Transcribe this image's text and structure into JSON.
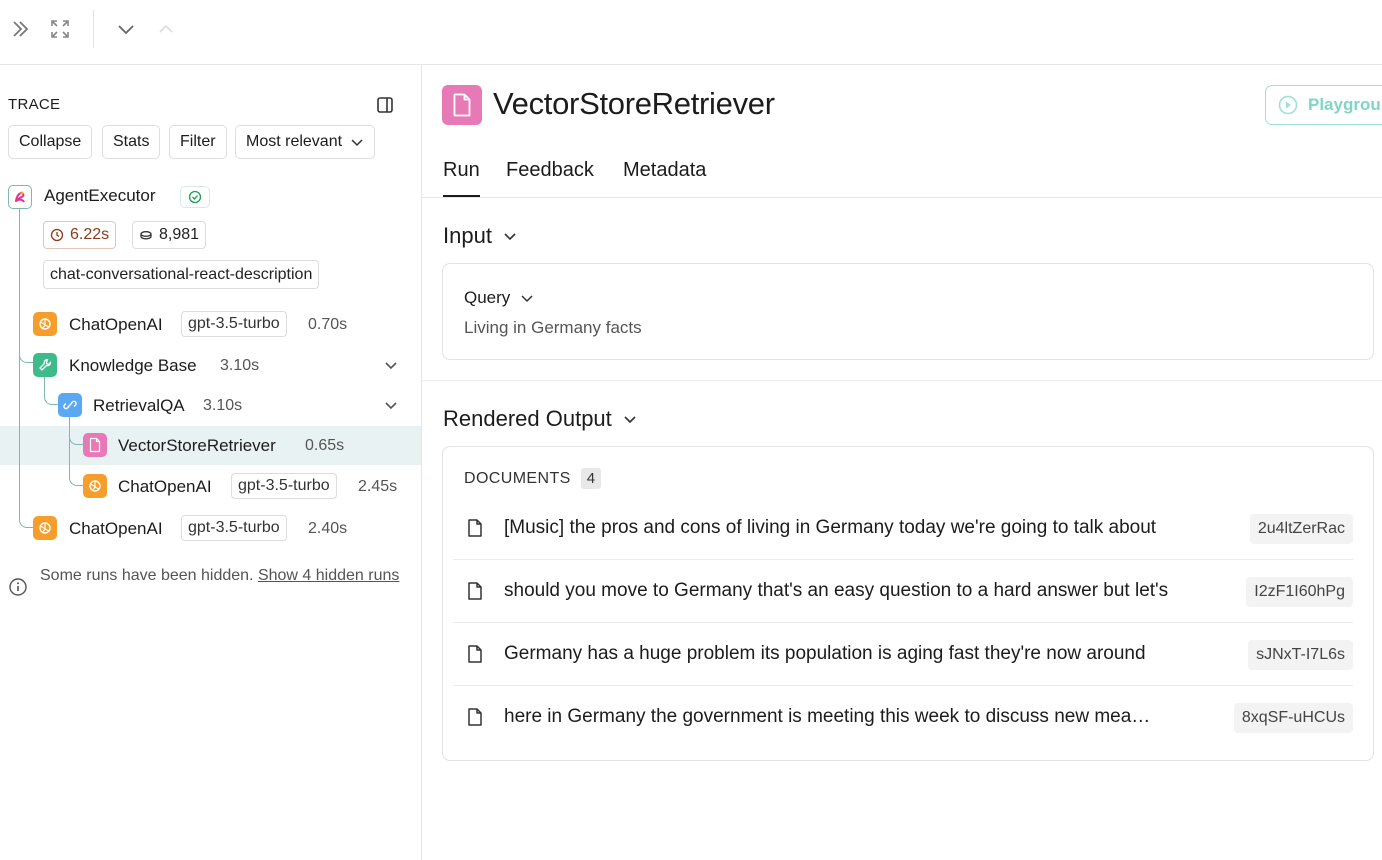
{
  "toolbar": {
    "expand_icon": "double-chevron-right-icon",
    "fullscreen_icon": "expand-arrows-icon",
    "next_icon": "chevron-down-icon",
    "prev_icon": "chevron-up-icon"
  },
  "trace": {
    "title": "TRACE",
    "buttons": {
      "collapse": "Collapse",
      "stats": "Stats",
      "filter": "Filter",
      "sort": "Most relevant"
    },
    "root": {
      "name": "AgentExecutor",
      "status": "success",
      "latency": "6.22s",
      "tokens": "8,981",
      "tag": "chat-conversational-react-description"
    },
    "runs": [
      {
        "name": "ChatOpenAI",
        "model": "gpt-3.5-turbo",
        "time": "0.70s",
        "type": "llm"
      },
      {
        "name": "Knowledge Base",
        "time": "3.10s",
        "type": "tool"
      },
      {
        "name": "RetrievalQA",
        "time": "3.10s",
        "type": "chain"
      },
      {
        "name": "VectorStoreRetriever",
        "time": "0.65s",
        "type": "retriever"
      },
      {
        "name": "ChatOpenAI",
        "model": "gpt-3.5-turbo",
        "time": "2.45s",
        "type": "llm"
      },
      {
        "name": "ChatOpenAI",
        "model": "gpt-3.5-turbo",
        "time": "2.40s",
        "type": "llm"
      }
    ],
    "hidden_notice": "Some runs have been hidden.",
    "hidden_link": "Show 4 hidden runs"
  },
  "detail": {
    "title": "VectorStoreRetriever",
    "playground": "Playground",
    "tabs": [
      "Run",
      "Feedback",
      "Metadata"
    ],
    "input": {
      "title": "Input",
      "query_label": "Query",
      "query_value": "Living in Germany facts"
    },
    "output": {
      "title": "Rendered Output",
      "documents_label": "DOCUMENTS",
      "documents_count": "4",
      "documents": [
        {
          "text": "[Music] the pros and cons of living in Germany today we're going to talk about",
          "id": "2u4ltZerRac"
        },
        {
          "text": "should you move to Germany that's an easy question to a hard answer but let's",
          "id": "I2zF1I60hPg"
        },
        {
          "text": "Germany has a huge problem its population is aging fast they're now around",
          "id": "sJNxT-I7L6s"
        },
        {
          "text": "here in Germany the government is meeting this week to discuss new measures",
          "id": "8xqSF-uHCUs"
        }
      ]
    }
  },
  "colors": {
    "accent_teal": "#7fb7b1",
    "llm_orange": "#f59e2c",
    "tool_green": "#3dbb8a",
    "chain_blue": "#5aa7f2",
    "retriever_pink": "#e879b7",
    "selected_bg": "#e9f2f2"
  }
}
